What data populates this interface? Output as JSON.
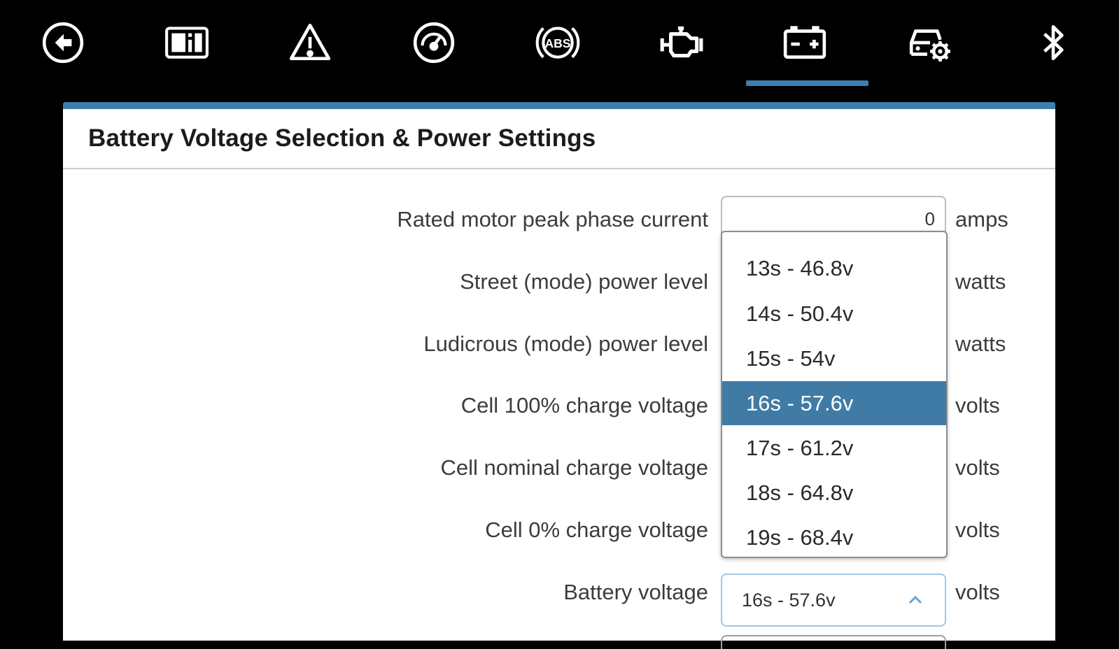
{
  "toolbar": {
    "icons": [
      "back-icon",
      "dashboard-info-icon",
      "warning-icon",
      "speedometer-icon",
      "abs-icon",
      "engine-icon",
      "battery-icon",
      "vehicle-settings-icon",
      "bluetooth-icon"
    ],
    "active": "battery-icon",
    "accent": "#3b7fb0",
    "abs_text": "ABS"
  },
  "panel": {
    "title": "Battery Voltage Selection & Power Settings",
    "rows": [
      {
        "label": "Rated motor peak phase current",
        "unit": "amps"
      },
      {
        "label": "Street (mode) power level",
        "unit": "watts"
      },
      {
        "label": "Ludicrous (mode) power level",
        "unit": "watts"
      },
      {
        "label": "Cell 100% charge voltage",
        "unit": "volts"
      },
      {
        "label": "Cell nominal charge voltage",
        "unit": "volts"
      },
      {
        "label": "Cell 0% charge voltage",
        "unit": "volts"
      },
      {
        "label": "Battery voltage",
        "unit": "volts"
      }
    ],
    "peak_current_value": "0",
    "battery_voltage": {
      "selected": "16s - 57.6v",
      "options": [
        "13s - 46.8v",
        "14s - 50.4v",
        "15s - 54v",
        "16s - 57.6v",
        "17s - 61.2v",
        "18s - 64.8v",
        "19s - 68.4v"
      ],
      "selected_color": "#3f7ba5"
    }
  }
}
